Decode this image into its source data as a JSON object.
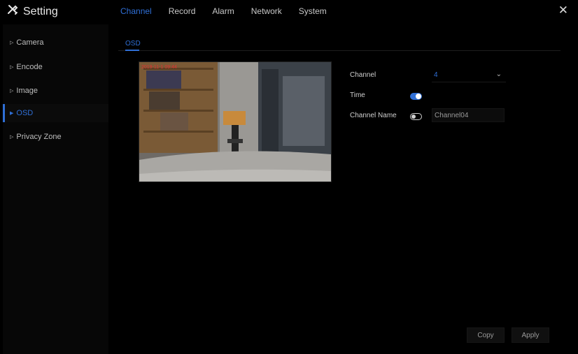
{
  "app": {
    "title": "Setting",
    "icon": "tools-icon"
  },
  "tabs": [
    {
      "label": "Channel",
      "active": true
    },
    {
      "label": "Record",
      "active": false
    },
    {
      "label": "Alarm",
      "active": false
    },
    {
      "label": "Network",
      "active": false
    },
    {
      "label": "System",
      "active": false
    }
  ],
  "sidebar": {
    "items": [
      {
        "label": "Camera",
        "active": false
      },
      {
        "label": "Encode",
        "active": false
      },
      {
        "label": "Image",
        "active": false
      },
      {
        "label": "OSD",
        "active": true
      },
      {
        "label": "Privacy Zone",
        "active": false
      }
    ]
  },
  "subtab": {
    "label": "OSD"
  },
  "form": {
    "channel_label": "Channel",
    "channel_value": "4",
    "time_label": "Time",
    "time_enabled": true,
    "channel_name_label": "Channel Name",
    "channel_name_enabled": false,
    "channel_name_value": "Channel04"
  },
  "buttons": {
    "copy": "Copy",
    "apply": "Apply"
  },
  "colors": {
    "accent": "#2f6fd6",
    "background": "#000000",
    "sidebar": "#070707"
  }
}
